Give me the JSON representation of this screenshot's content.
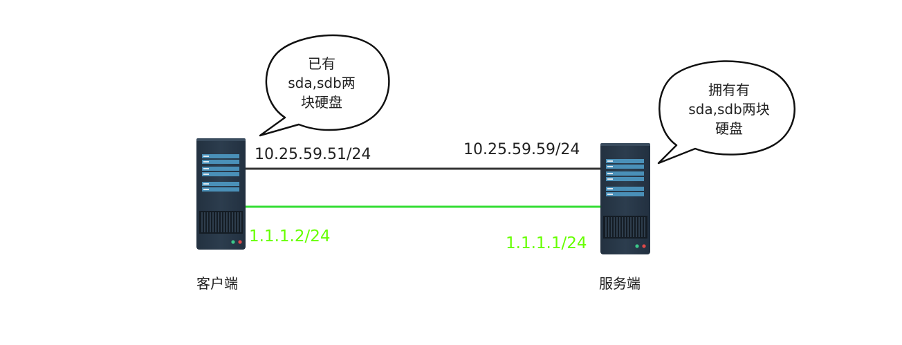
{
  "client": {
    "role_label": "客户端",
    "ip_primary": "10.25.59.51/24",
    "ip_secondary": "1.1.1.2/24",
    "bubble_lines": [
      "已有",
      "sda,sdb两",
      "块硬盘"
    ]
  },
  "server": {
    "role_label": "服务端",
    "ip_primary": "10.25.59.59/24",
    "ip_secondary": "1.1.1.1/24",
    "bubble_lines": [
      "拥有有",
      "sda,sdb两块",
      "硬盘"
    ]
  },
  "colors": {
    "primary_link": "#333333",
    "secondary_link": "#33dd33",
    "secondary_text": "#66ff00",
    "server_body": "#2a3a4a",
    "server_slot": "#4a90b8"
  }
}
